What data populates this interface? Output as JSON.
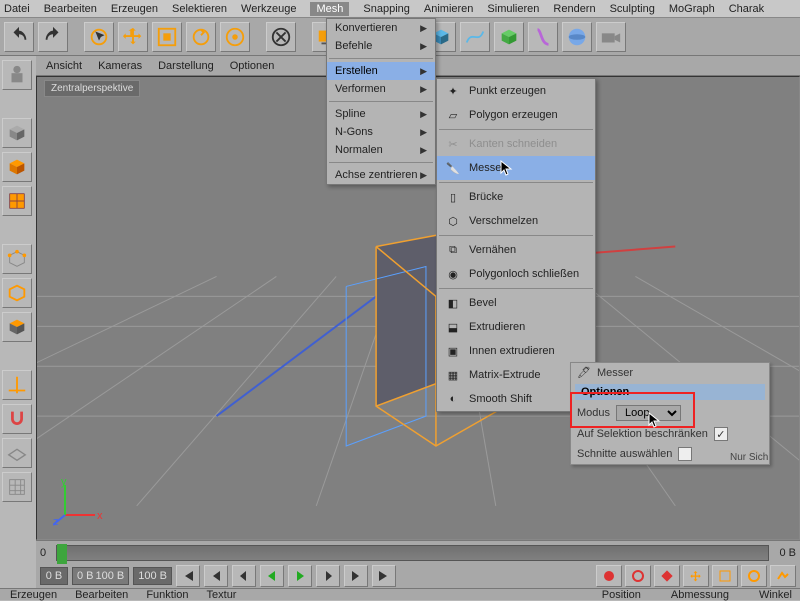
{
  "menubar": {
    "items": [
      "Datei",
      "Bearbeiten",
      "Erzeugen",
      "Selektieren",
      "Werkzeuge",
      "Mesh",
      "Snapping",
      "Animieren",
      "Simulieren",
      "Rendern",
      "Sculpting",
      "MoGraph",
      "Charak"
    ],
    "selected_index": 5
  },
  "viewport_header": {
    "items": [
      "Ansicht",
      "Kameras",
      "Darstellung",
      "Optionen"
    ]
  },
  "viewport_label": "Zentralperspektive",
  "mesh_menu": {
    "konvertieren": "Konvertieren",
    "befehle": "Befehle",
    "erstellen": "Erstellen",
    "verformen": "Verformen",
    "spline": "Spline",
    "ngons": "N-Gons",
    "normalen": "Normalen",
    "achse": "Achse zentrieren"
  },
  "submenu": {
    "punkt": "Punkt erzeugen",
    "polygon": "Polygon erzeugen",
    "kanten": "Kanten schneiden",
    "messer": "Messer",
    "bruecke": "Brücke",
    "verschmelzen": "Verschmelzen",
    "vernaehen": "Vernähen",
    "polyloch": "Polygonloch schließen",
    "bevel": "Bevel",
    "extrudieren": "Extrudieren",
    "innen": "Innen extrudieren",
    "matrix": "Matrix-Extrude",
    "smooth": "Smooth Shift"
  },
  "attr_panel": {
    "title": "Messer",
    "tab": "Optionen",
    "mode_label": "Modus",
    "mode_value": "Loop",
    "restrict": "Auf Selektion beschränken",
    "select_cuts": "Schnitte auswählen",
    "truncated": "Nur Sich"
  },
  "timeline": {
    "start": "0",
    "end": "0 B",
    "t_start": "0 B",
    "t_range_a": "0 B",
    "t_range_b": "100 B",
    "t_field": "100 B"
  },
  "bottombar": {
    "erzeugen": "Erzeugen",
    "bearbeiten": "Bearbeiten",
    "funktion": "Funktion",
    "textur": "Textur",
    "position": "Position",
    "abmessung": "Abmessung",
    "winkel": "Winkel"
  },
  "icons": {
    "undo": "undo-icon",
    "redo": "redo-icon"
  }
}
